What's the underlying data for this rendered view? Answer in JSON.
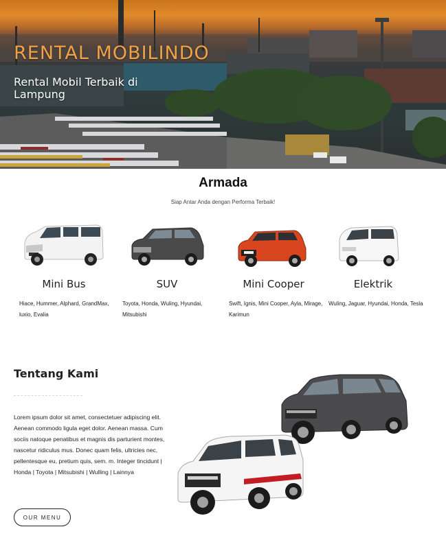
{
  "hero": {
    "title": "RENTAL MOBILINDO",
    "subtitle": "Rental Mobil Terbaik di Lampung"
  },
  "armada": {
    "title": "Armada",
    "subtitle": "Siap Antar Anda dengan Performa Terbaik!",
    "items": [
      {
        "name": "Mini Bus",
        "desc": "Hiace, Hummer, Alphard, GrandMax, luxio, Evalia",
        "icon": "minibus-image",
        "color": "#f1f1f1"
      },
      {
        "name": "SUV",
        "desc": "Toyota, Honda, Wuling, Hyundai, Mitsubishi",
        "icon": "suv-image",
        "color": "#3d3d3d"
      },
      {
        "name": "Mini Cooper",
        "desc": "Swift, Ignis, Mini Cooper, Ayla, Mirage, Karimun",
        "icon": "mini-car-image",
        "color": "#d8401c"
      },
      {
        "name": "Elektrik",
        "desc": "Wuling, Jaguar, Hyundai, Honda, Tesla",
        "icon": "electric-car-image",
        "color": "#f4f4f4"
      }
    ]
  },
  "tentang": {
    "title": "Tentang Kami",
    "body": "Lorem ipsum dolor sit amet, consectetuer adipiscing elit. Aenean commodo ligula eget dolor. Aenean massa. Cum sociis natoque penatibus et magnis dis parturient montes, nascetur ridiculus mus. Donec quam felis, ultricies nec, pellentesque eu, pretium quis, sem. m. Integer tincidunt | Honda | Toyota | Mitsubishi | Wulling | Lainnya",
    "button": "OUR MENU"
  },
  "colors": {
    "accent": "#f2a244",
    "sky": "#e08a2a"
  }
}
